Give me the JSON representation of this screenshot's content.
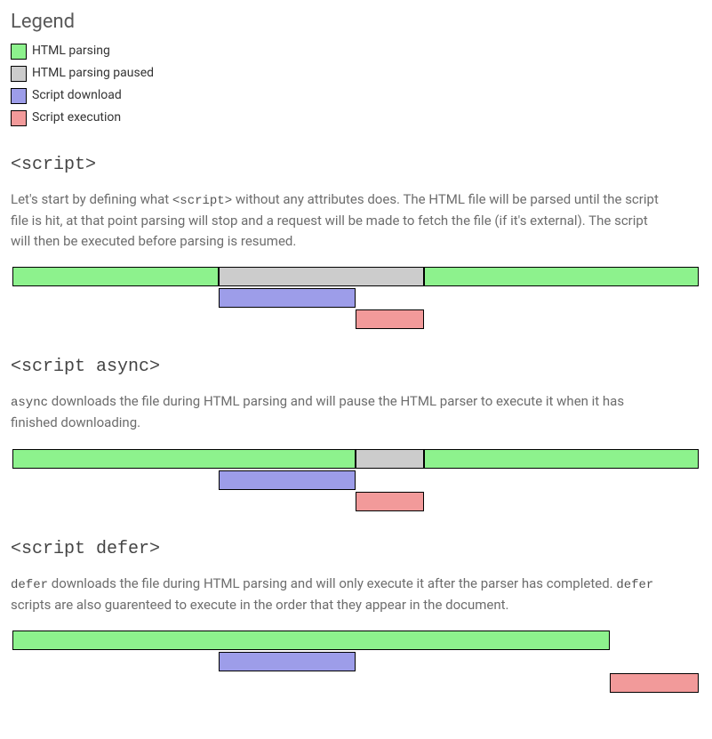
{
  "legend": {
    "title": "Legend",
    "items": [
      {
        "label": "HTML parsing",
        "color": "#8df28d"
      },
      {
        "label": "HTML parsing paused",
        "color": "#cccccc"
      },
      {
        "label": "Script download",
        "color": "#9d9de9"
      },
      {
        "label": "Script execution",
        "color": "#f29a9a"
      }
    ]
  },
  "colors": {
    "parse": "#8df28d",
    "paused": "#cccccc",
    "download": "#9d9de9",
    "exec": "#f29a9a"
  },
  "chart_data": [
    {
      "id": "plain",
      "title": "<script>",
      "desc_segments": [
        {
          "text": "Let's start by defining what ",
          "mono": false
        },
        {
          "text": "<script>",
          "mono": true
        },
        {
          "text": " without any attributes does. The HTML file will be parsed until the script file is hit, at that point parsing will stop and a request will be made to fetch the file (if it's external). The script will then be executed before parsing is resumed.",
          "mono": false
        }
      ],
      "rows": [
        [
          {
            "type": "parse",
            "start": 0,
            "end": 30
          },
          {
            "type": "paused",
            "start": 30,
            "end": 60
          },
          {
            "type": "parse",
            "start": 60,
            "end": 100
          }
        ],
        [
          {
            "type": "download",
            "start": 30,
            "end": 50
          }
        ],
        [
          {
            "type": "exec",
            "start": 50,
            "end": 60
          }
        ]
      ]
    },
    {
      "id": "async",
      "title": "<script async>",
      "desc_segments": [
        {
          "text": "async",
          "mono": true
        },
        {
          "text": " downloads the file during HTML parsing and will pause the HTML parser to execute it when it has finished downloading.",
          "mono": false
        }
      ],
      "rows": [
        [
          {
            "type": "parse",
            "start": 0,
            "end": 50
          },
          {
            "type": "paused",
            "start": 50,
            "end": 60
          },
          {
            "type": "parse",
            "start": 60,
            "end": 100
          }
        ],
        [
          {
            "type": "download",
            "start": 30,
            "end": 50
          }
        ],
        [
          {
            "type": "exec",
            "start": 50,
            "end": 60
          }
        ]
      ]
    },
    {
      "id": "defer",
      "title": "<script defer>",
      "desc_segments": [
        {
          "text": "defer",
          "mono": true
        },
        {
          "text": " downloads the file during HTML parsing and will only execute it after the parser has completed. ",
          "mono": false
        },
        {
          "text": "defer",
          "mono": true
        },
        {
          "text": " scripts are also guarenteed to execute in the order that they appear in the document.",
          "mono": false
        }
      ],
      "rows": [
        [
          {
            "type": "parse",
            "start": 0,
            "end": 87
          }
        ],
        [
          {
            "type": "download",
            "start": 30,
            "end": 50
          }
        ],
        [
          {
            "type": "exec",
            "start": 87,
            "end": 100
          }
        ]
      ]
    }
  ]
}
